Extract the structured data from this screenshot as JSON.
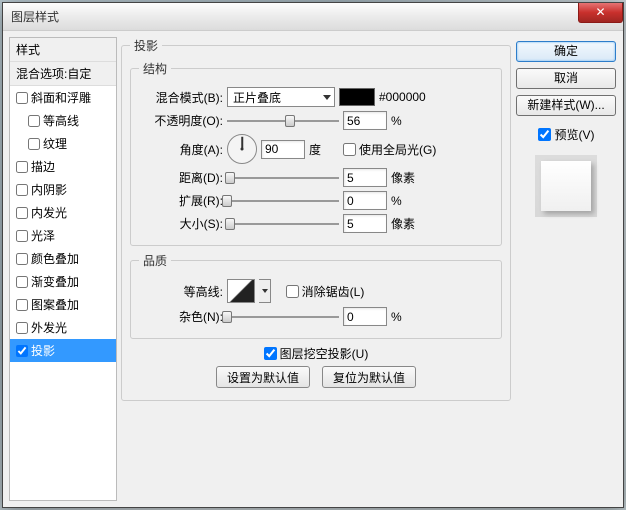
{
  "dialog": {
    "title": "图层样式",
    "close_glyph": "✕"
  },
  "sidebar": {
    "header": "样式",
    "blend": "混合选项:自定",
    "items": [
      {
        "label": "斜面和浮雕",
        "checked": false,
        "indent": false
      },
      {
        "label": "等高线",
        "checked": false,
        "indent": true
      },
      {
        "label": "纹理",
        "checked": false,
        "indent": true
      },
      {
        "label": "描边",
        "checked": false,
        "indent": false
      },
      {
        "label": "内阴影",
        "checked": false,
        "indent": false
      },
      {
        "label": "内发光",
        "checked": false,
        "indent": false
      },
      {
        "label": "光泽",
        "checked": false,
        "indent": false
      },
      {
        "label": "颜色叠加",
        "checked": false,
        "indent": false
      },
      {
        "label": "渐变叠加",
        "checked": false,
        "indent": false
      },
      {
        "label": "图案叠加",
        "checked": false,
        "indent": false
      },
      {
        "label": "外发光",
        "checked": false,
        "indent": false
      },
      {
        "label": "投影",
        "checked": true,
        "indent": false,
        "selected": true
      }
    ]
  },
  "main": {
    "group_title": "投影",
    "structure": {
      "legend": "结构",
      "blend_mode_label": "混合模式(B):",
      "blend_mode_value": "正片叠底",
      "color_hex": "#000000",
      "opacity_label": "不透明度(O):",
      "opacity_value": "56",
      "opacity_unit": "%",
      "angle_label": "角度(A):",
      "angle_value": "90",
      "angle_unit": "度",
      "global_light_label": "使用全局光(G)",
      "global_light_checked": false,
      "distance_label": "距离(D):",
      "distance_value": "5",
      "distance_unit": "像素",
      "spread_label": "扩展(R):",
      "spread_value": "0",
      "spread_unit": "%",
      "size_label": "大小(S):",
      "size_value": "5",
      "size_unit": "像素"
    },
    "quality": {
      "legend": "品质",
      "contour_label": "等高线:",
      "antialias_label": "消除锯齿(L)",
      "antialias_checked": false,
      "noise_label": "杂色(N):",
      "noise_value": "0",
      "noise_unit": "%"
    },
    "knockout_label": "图层挖空投影(U)",
    "knockout_checked": true,
    "btn_default": "设置为默认值",
    "btn_reset": "复位为默认值"
  },
  "right": {
    "ok": "确定",
    "cancel": "取消",
    "new_style": "新建样式(W)...",
    "preview_label": "预览(V)",
    "preview_checked": true
  }
}
